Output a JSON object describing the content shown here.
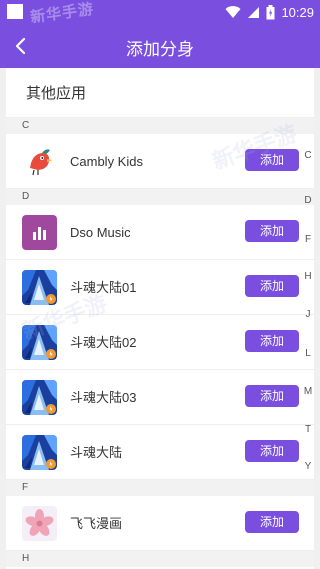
{
  "status_bar": {
    "time": "10:29",
    "watermark": "新华手游"
  },
  "app_bar": {
    "title": "添加分身"
  },
  "section": {
    "title": "其他应用"
  },
  "groups": [
    {
      "letter": "C",
      "items": [
        {
          "name": "Cambly Kids",
          "button": "添加",
          "icon": "bird-app-icon"
        }
      ]
    },
    {
      "letter": "D",
      "items": [
        {
          "name": "Dso Music",
          "button": "添加",
          "icon": "music-bars-icon"
        },
        {
          "name": "斗魂大陆01",
          "button": "添加",
          "icon": "game-art-icon"
        },
        {
          "name": "斗魂大陆02",
          "button": "添加",
          "icon": "game-art-icon"
        },
        {
          "name": "斗魂大陆03",
          "button": "添加",
          "icon": "game-art-icon"
        },
        {
          "name": "斗魂大陆",
          "button": "添加",
          "icon": "game-art-icon"
        }
      ]
    },
    {
      "letter": "F",
      "items": [
        {
          "name": "飞飞漫画",
          "button": "添加",
          "icon": "blossom-icon"
        }
      ]
    },
    {
      "letter": "H",
      "items": []
    }
  ],
  "index_letters": [
    "C",
    "D",
    "F",
    "H",
    "J",
    "L",
    "M",
    "T",
    "Y"
  ],
  "colors": {
    "accent": "#7a4fe0"
  }
}
